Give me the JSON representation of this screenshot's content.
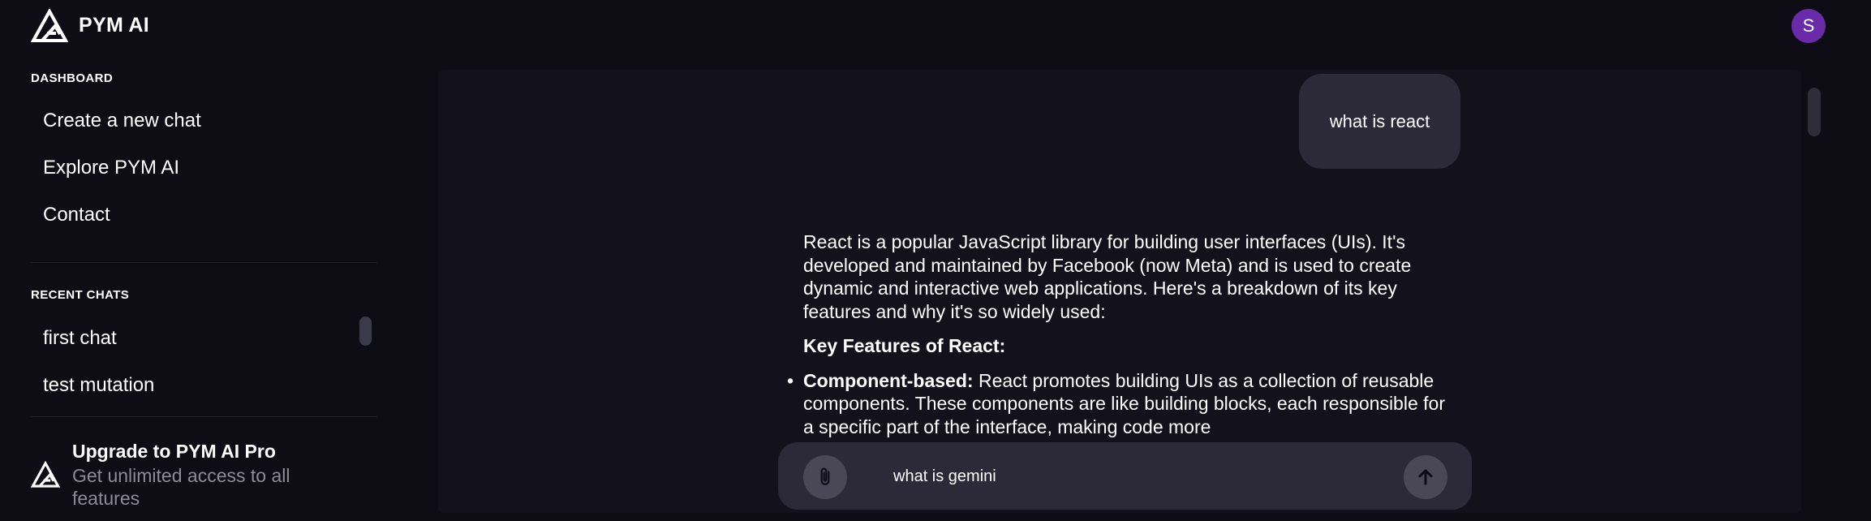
{
  "header": {
    "brand": "PYM AI",
    "avatar_initial": "S"
  },
  "sidebar": {
    "dashboard_label": "DASHBOARD",
    "dashboard_items": [
      {
        "label": "Create a new chat"
      },
      {
        "label": "Explore PYM AI"
      },
      {
        "label": "Contact"
      }
    ],
    "recent_label": "RECENT CHATS",
    "recent_items": [
      {
        "label": "first chat"
      },
      {
        "label": "test mutation"
      }
    ],
    "upgrade": {
      "title": "Upgrade to PYM AI Pro",
      "subtitle": "Get unlimited access to all features"
    }
  },
  "chat": {
    "user_message": "what is react",
    "answer": {
      "intro": "React is a popular JavaScript library for building user interfaces (UIs). It's developed and maintained by Facebook (now Meta) and is used to create dynamic and interactive web applications. Here's a breakdown of its key features and why it's so widely used:",
      "heading": "Key Features of React:",
      "items": [
        {
          "term": "Component-based:",
          "text": " React promotes building UIs as a collection of reusable components. These components are like building blocks, each responsible for a specific part of the interface, making code more"
        }
      ]
    }
  },
  "composer": {
    "input_value": "what is gemini"
  },
  "colors": {
    "background": "#0e0c15",
    "panel": "#13111b",
    "bubble": "#2c2a38",
    "avatar": "#6a2bab",
    "muted_text": "#8d8b96"
  },
  "icons": {
    "logo": "pym-triangle-logo",
    "attach": "paperclip-icon",
    "send": "arrow-up-icon"
  }
}
